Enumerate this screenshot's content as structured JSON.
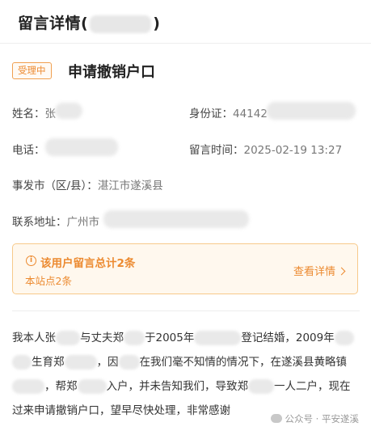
{
  "header": {
    "title_prefix": "留言详情(",
    "title_suffix": ")"
  },
  "message": {
    "status": "受理中",
    "subject": "申请撤销户口"
  },
  "fields": {
    "name_label": "姓名：",
    "name_value": "张",
    "id_label": "身份证：",
    "id_value": "44142",
    "phone_label": "电话：",
    "time_label": "留言时间：",
    "time_value": "2025-02-19 13:27",
    "region_label": "事发市（区/县）：",
    "region_value": "湛江市遂溪县",
    "address_label": "联系地址：",
    "address_value": "广州市"
  },
  "summary": {
    "icon": "info-icon",
    "title": "该用户留言总计2条",
    "subtitle": "本站点2条",
    "link": "查看详情"
  },
  "content_lines": [
    [
      "我本人张",
      "与丈夫郑",
      "于2005年",
      "登记结婚，2009年"
    ],
    [
      "生育郑",
      "，因",
      "在我们毫不知情的情况下，在遂溪县黄略镇"
    ],
    [
      "，帮郑",
      "入户，并未告知我们，导致郑",
      "一人二户，现在"
    ],
    [
      "过来申请撤销户口，望早尽快处理，非常感谢"
    ]
  ],
  "watermark": {
    "text": "公众号 · 平安遂溪",
    "icon": "wechat-icon"
  }
}
